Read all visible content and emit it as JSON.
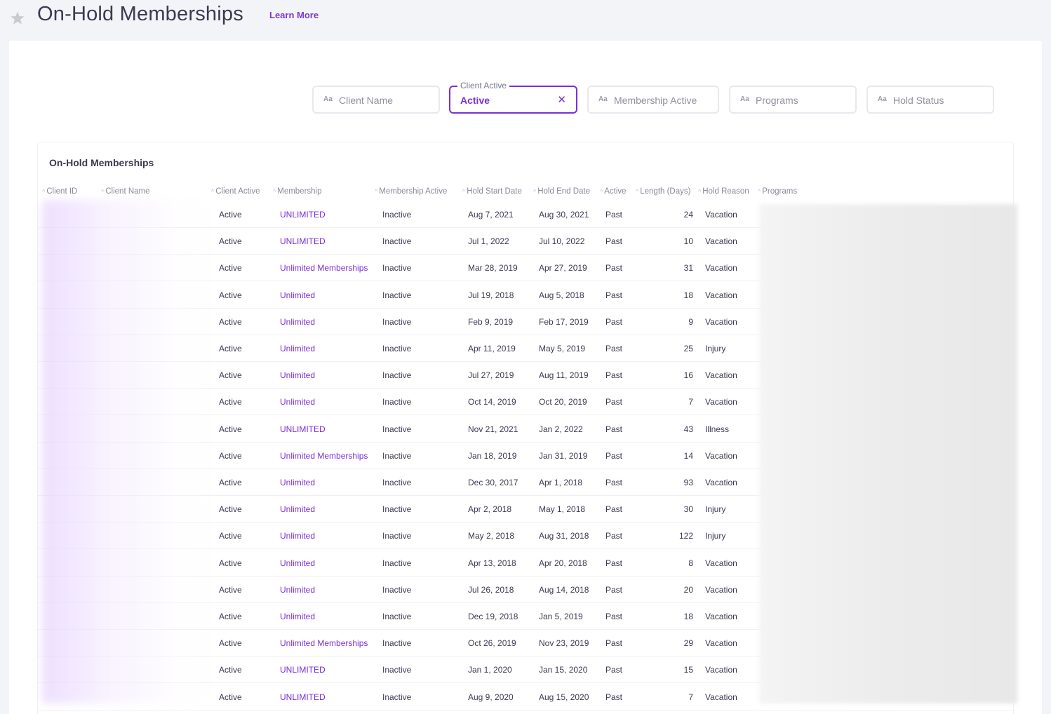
{
  "header": {
    "title": "On-Hold Memberships",
    "learn_more": "Learn More"
  },
  "filters": {
    "client_name": {
      "placeholder": "Client Name",
      "aa": "Aa"
    },
    "client_active": {
      "label": "Client Active",
      "value": "Active"
    },
    "membership_active": {
      "placeholder": "Membership Active",
      "aa": "Aa"
    },
    "programs": {
      "placeholder": "Programs",
      "aa": "Aa"
    },
    "hold_status": {
      "placeholder": "Hold Status",
      "aa": "Aa"
    }
  },
  "table": {
    "title": "On-Hold Memberships",
    "columns": [
      "Client ID",
      "Client Name",
      "Client Active",
      "Membership",
      "Membership Active",
      "Hold Start Date",
      "Hold End Date",
      "Active",
      "Length (Days)",
      "Hold Reason",
      "Programs"
    ],
    "rows": [
      {
        "client_active": "Active",
        "membership": "UNLIMITED",
        "membership_active": "Inactive",
        "start": "Aug 7, 2021",
        "end": "Aug 30, 2021",
        "active": "Past",
        "length": "24",
        "reason": "Vacation"
      },
      {
        "client_active": "Active",
        "membership": "UNLIMITED",
        "membership_active": "Inactive",
        "start": "Jul 1, 2022",
        "end": "Jul 10, 2022",
        "active": "Past",
        "length": "10",
        "reason": "Vacation"
      },
      {
        "client_active": "Active",
        "membership": "Unlimited Memberships",
        "membership_active": "Inactive",
        "start": "Mar 28, 2019",
        "end": "Apr 27, 2019",
        "active": "Past",
        "length": "31",
        "reason": "Vacation"
      },
      {
        "client_active": "Active",
        "membership": "Unlimited",
        "membership_active": "Inactive",
        "start": "Jul 19, 2018",
        "end": "Aug 5, 2018",
        "active": "Past",
        "length": "18",
        "reason": "Vacation"
      },
      {
        "client_active": "Active",
        "membership": "Unlimited",
        "membership_active": "Inactive",
        "start": "Feb 9, 2019",
        "end": "Feb 17, 2019",
        "active": "Past",
        "length": "9",
        "reason": "Vacation"
      },
      {
        "client_active": "Active",
        "membership": "Unlimited",
        "membership_active": "Inactive",
        "start": "Apr 11, 2019",
        "end": "May 5, 2019",
        "active": "Past",
        "length": "25",
        "reason": "Injury"
      },
      {
        "client_active": "Active",
        "membership": "Unlimited",
        "membership_active": "Inactive",
        "start": "Jul 27, 2019",
        "end": "Aug 11, 2019",
        "active": "Past",
        "length": "16",
        "reason": "Vacation"
      },
      {
        "client_active": "Active",
        "membership": "Unlimited",
        "membership_active": "Inactive",
        "start": "Oct 14, 2019",
        "end": "Oct 20, 2019",
        "active": "Past",
        "length": "7",
        "reason": "Vacation"
      },
      {
        "client_active": "Active",
        "membership": "UNLIMITED",
        "membership_active": "Inactive",
        "start": "Nov 21, 2021",
        "end": "Jan 2, 2022",
        "active": "Past",
        "length": "43",
        "reason": "Illness"
      },
      {
        "client_active": "Active",
        "membership": "Unlimited Memberships",
        "membership_active": "Inactive",
        "start": "Jan 18, 2019",
        "end": "Jan 31, 2019",
        "active": "Past",
        "length": "14",
        "reason": "Vacation"
      },
      {
        "client_active": "Active",
        "membership": "Unlimited",
        "membership_active": "Inactive",
        "start": "Dec 30, 2017",
        "end": "Apr 1, 2018",
        "active": "Past",
        "length": "93",
        "reason": "Vacation"
      },
      {
        "client_active": "Active",
        "membership": "Unlimited",
        "membership_active": "Inactive",
        "start": "Apr 2, 2018",
        "end": "May 1, 2018",
        "active": "Past",
        "length": "30",
        "reason": "Injury"
      },
      {
        "client_active": "Active",
        "membership": "Unlimited",
        "membership_active": "Inactive",
        "start": "May 2, 2018",
        "end": "Aug 31, 2018",
        "active": "Past",
        "length": "122",
        "reason": "Injury"
      },
      {
        "client_active": "Active",
        "membership": "Unlimited",
        "membership_active": "Inactive",
        "start": "Apr 13, 2018",
        "end": "Apr 20, 2018",
        "active": "Past",
        "length": "8",
        "reason": "Vacation"
      },
      {
        "client_active": "Active",
        "membership": "Unlimited",
        "membership_active": "Inactive",
        "start": "Jul 26, 2018",
        "end": "Aug 14, 2018",
        "active": "Past",
        "length": "20",
        "reason": "Vacation"
      },
      {
        "client_active": "Active",
        "membership": "Unlimited",
        "membership_active": "Inactive",
        "start": "Dec 19, 2018",
        "end": "Jan 5, 2019",
        "active": "Past",
        "length": "18",
        "reason": "Vacation"
      },
      {
        "client_active": "Active",
        "membership": "Unlimited Memberships",
        "membership_active": "Inactive",
        "start": "Oct 26, 2019",
        "end": "Nov 23, 2019",
        "active": "Past",
        "length": "29",
        "reason": "Vacation"
      },
      {
        "client_active": "Active",
        "membership": "UNLIMITED",
        "membership_active": "Inactive",
        "start": "Jan 1, 2020",
        "end": "Jan 15, 2020",
        "active": "Past",
        "length": "15",
        "reason": "Vacation"
      },
      {
        "client_active": "Active",
        "membership": "UNLIMITED",
        "membership_active": "Inactive",
        "start": "Aug 9, 2020",
        "end": "Aug 15, 2020",
        "active": "Past",
        "length": "7",
        "reason": "Vacation"
      }
    ]
  },
  "colors": {
    "accent": "#7b2fd6",
    "text": "#3c3a52",
    "muted": "#8a8a9a",
    "background": "#f3f4f7"
  },
  "icons": {
    "favorite": "star-icon",
    "clear": "close-icon",
    "text_filter": "text-format-icon"
  }
}
